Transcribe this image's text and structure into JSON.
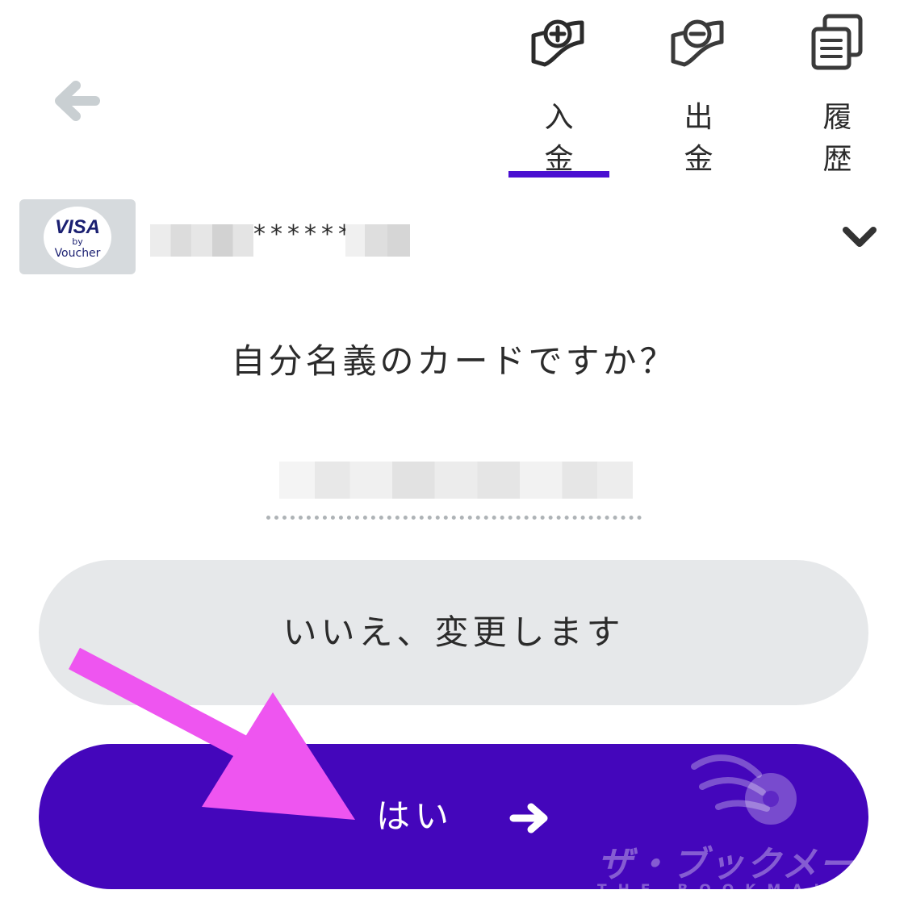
{
  "header": {
    "back_icon": "arrow-left-icon",
    "tabs": [
      {
        "label": "入金",
        "icon": "deposit-plus-icon",
        "active": true
      },
      {
        "label": "出金",
        "icon": "withdraw-minus-icon",
        "active": false
      },
      {
        "label": "履歴",
        "icon": "history-documents-icon",
        "active": false
      }
    ],
    "accent_color": "#4a0fd1"
  },
  "card": {
    "logo_brand": "VISA",
    "logo_by": "by",
    "logo_voucher": "Voucher",
    "number_masked": "******",
    "dropdown_icon": "chevron-down-icon"
  },
  "confirm": {
    "question": "自分名義のカードですか？",
    "no_label": "いいえ、変更します",
    "yes_label": "はい",
    "yes_icon": "arrow-right-icon",
    "yes_color": "#4406bb",
    "no_color": "#e6e8ea"
  },
  "watermark": {
    "title": "ザ・ブックメーカーズ",
    "subtitle": "THE BOOKMAKERS"
  },
  "annotation": {
    "pointer": "pink-arrow-icon",
    "color": "#ee55f0"
  }
}
